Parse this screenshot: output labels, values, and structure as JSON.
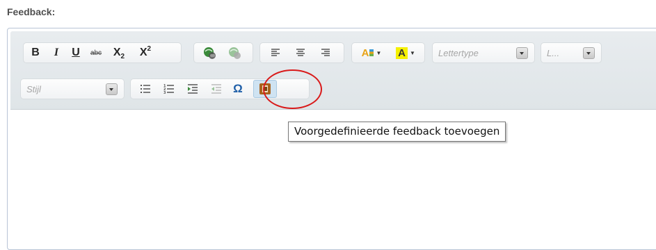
{
  "field": {
    "label": "Feedback:"
  },
  "toolbar": {
    "bold": "B",
    "italic": "I",
    "underline": "U",
    "strike": "abc",
    "subscript": "X",
    "subscript_sub": "2",
    "superscript": "X",
    "superscript_sup": "2",
    "link_icon": "link-icon",
    "unlink_icon": "unlink-icon",
    "font_placeholder": "Lettertype",
    "size_placeholder": "L...",
    "style_placeholder": "Stijl",
    "special_char": "Ω",
    "predefined_feedback_icon": "feedback-template-icon"
  },
  "tooltip": {
    "text": "Voorgedefinieerde feedback toevoegen"
  },
  "colors": {
    "highlight_circle": "#d91a1a",
    "text_color_a": "#e8a317",
    "bg_color_a": "#f5f000"
  }
}
